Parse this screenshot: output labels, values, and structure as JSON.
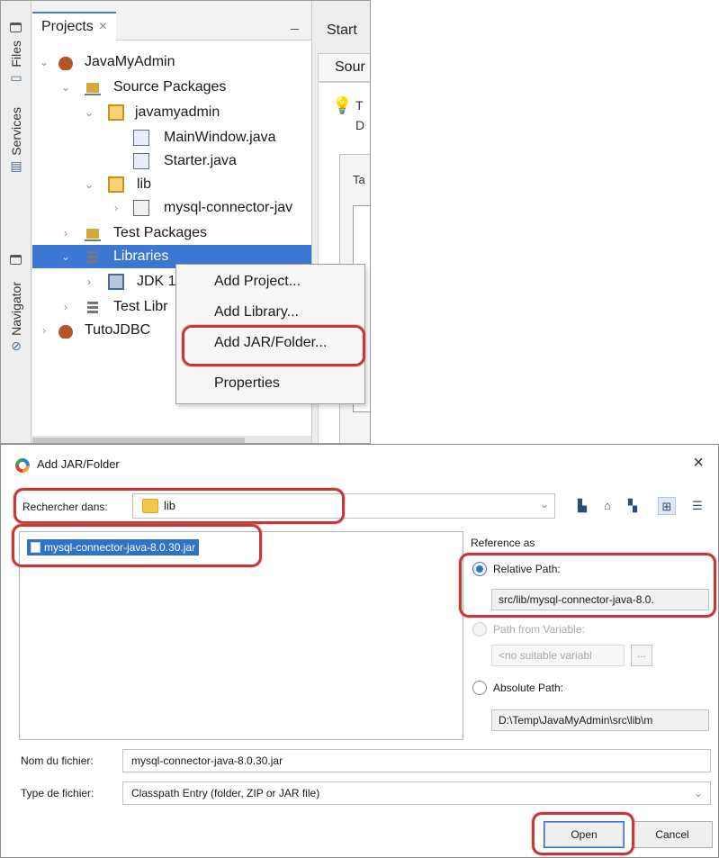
{
  "ide": {
    "side_tabs": {
      "files": "Files",
      "services": "Services",
      "navigator": "Navigator"
    },
    "projects_tab": {
      "label": "Projects",
      "close": "×",
      "minimize": "_"
    },
    "tree": [
      {
        "label": "JavaMyAdmin",
        "icon": "project-icon"
      },
      {
        "label": "Source Packages",
        "icon": "source-packages-icon"
      },
      {
        "label": "javamyadmin",
        "icon": "package-icon"
      },
      {
        "label": "MainWindow.java",
        "icon": "java-file-icon"
      },
      {
        "label": "Starter.java",
        "icon": "java-file-icon"
      },
      {
        "label": "lib",
        "icon": "package-icon"
      },
      {
        "label": "mysql-connector-jav",
        "icon": "jar-icon"
      },
      {
        "label": "Test Packages",
        "icon": "test-packages-icon"
      },
      {
        "label": "Libraries",
        "icon": "libraries-icon",
        "selected": true
      },
      {
        "label": "JDK 1",
        "icon": "jdk-icon"
      },
      {
        "label": "Test Libr",
        "icon": "libraries-icon"
      },
      {
        "label": "TutoJDBC",
        "icon": "project-icon"
      }
    ],
    "editor": {
      "start_tab": "Start",
      "source_tab": "Sour",
      "hint_t": "T",
      "hint_d": "D",
      "inner_tab": "Ta"
    },
    "context_menu": {
      "items": [
        "Add Project...",
        "Add Library...",
        "Add JAR/Folder...",
        "Properties"
      ],
      "highlighted": "Add JAR/Folder..."
    }
  },
  "dialog": {
    "title": "Add JAR/Folder",
    "close": "×",
    "look_in_label": "Rechercher dans:",
    "look_in_value": "lib",
    "toolbar_icons": [
      "up-folder-icon",
      "home-icon",
      "new-folder-icon",
      "list-view-icon",
      "details-view-icon"
    ],
    "files": [
      "mysql-connector-java-8.0.30.jar"
    ],
    "reference": {
      "label": "Reference as",
      "relative_label": "Relative Path:",
      "relative_value": "src/lib/mysql-connector-java-8.0.",
      "variable_label": "Path from Variable:",
      "variable_value": "<no suitable variabl",
      "variable_more": "...",
      "absolute_label": "Absolute Path:",
      "absolute_value": "D:\\Temp\\JavaMyAdmin\\src\\lib\\m"
    },
    "filename_label": "Nom du fichier:",
    "filename_value": "mysql-connector-java-8.0.30.jar",
    "filetype_label": "Type de fichier:",
    "filetype_value": "Classpath Entry (folder, ZIP or JAR file)",
    "open_button": "Open",
    "cancel_button": "Cancel"
  },
  "colors": {
    "selection": "#3c78d3",
    "highlight_outline": "#c33838",
    "folder": "#f4c84a"
  }
}
